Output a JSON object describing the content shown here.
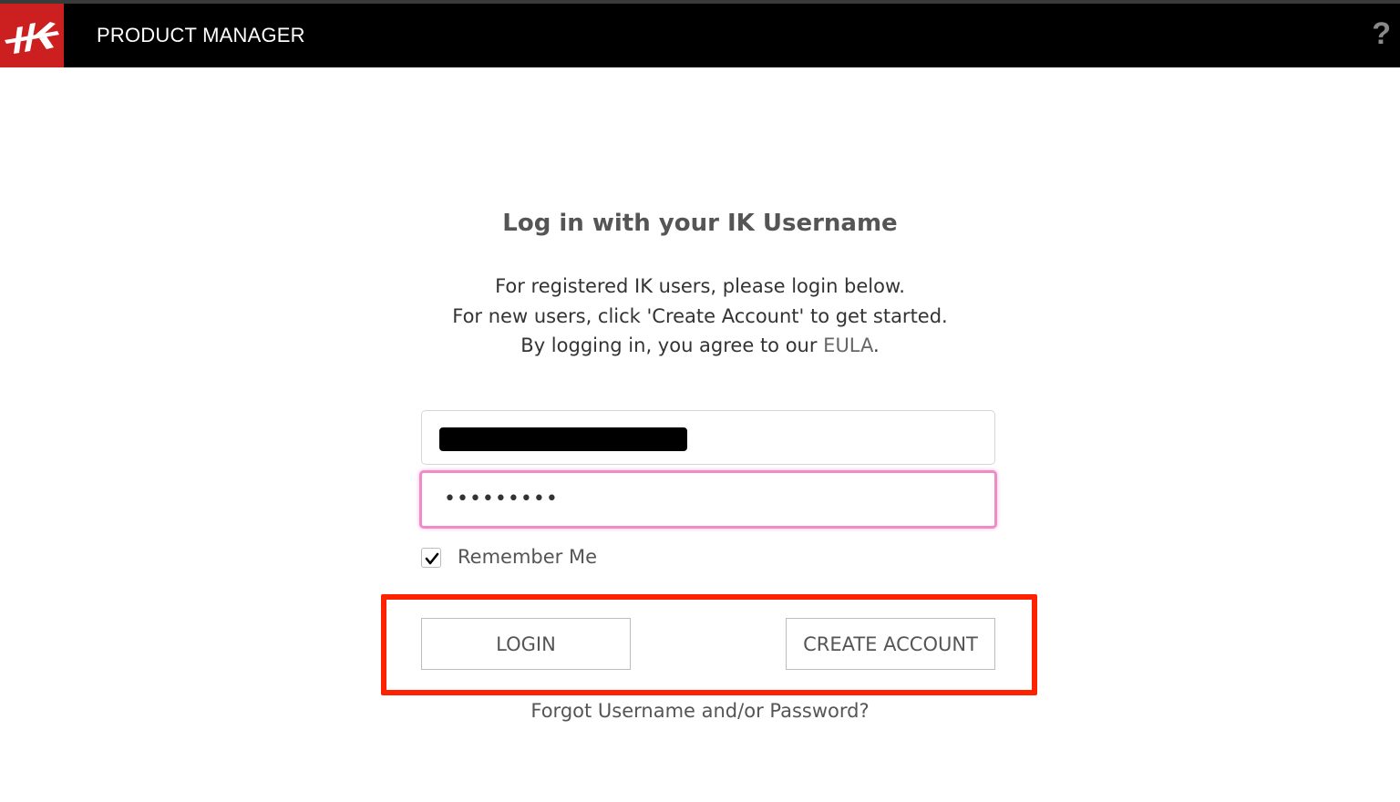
{
  "header": {
    "app_title": "PRODUCT MANAGER",
    "help_label": "?",
    "logo_icon": "ik-logo-icon",
    "colors": {
      "bar": "#000000",
      "logo_bg": "#cc1f1f"
    }
  },
  "login": {
    "title": "Log in with your IK Username",
    "intro_line1": "For registered IK users, please login below.",
    "intro_line2": "For new users, click 'Create Account' to get started.",
    "intro_line3_prefix": "By logging in, you agree to our ",
    "eula_link": "EULA",
    "intro_line3_suffix": ".",
    "password_value": "•••••••••",
    "remember_label": "Remember Me",
    "remember_checked": true,
    "login_button": "LOGIN",
    "create_account_button": "CREATE ACCOUNT",
    "forgot_link": "Forgot Username and/or Password?"
  },
  "annotation": {
    "highlight_color": "#ff2200",
    "focus_color": "#ee8cc8"
  }
}
